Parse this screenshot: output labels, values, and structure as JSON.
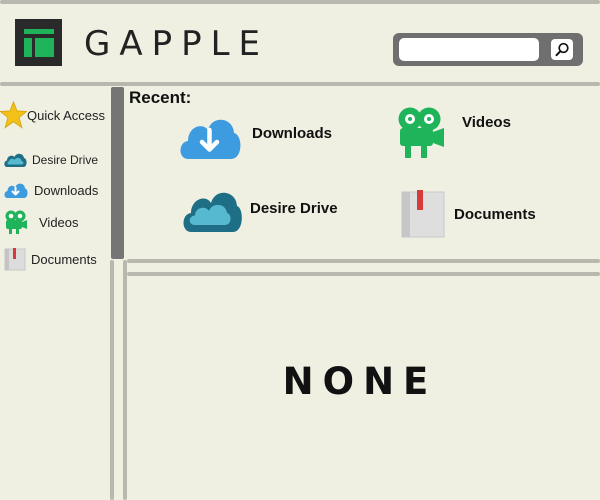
{
  "header": {
    "brand": "GAPPLE",
    "search": {
      "placeholder": "",
      "value": ""
    }
  },
  "sidebar": {
    "items": [
      {
        "label": "Quick Access",
        "icon": "star-icon"
      },
      {
        "label": "Desire Drive",
        "icon": "cloud-icon"
      },
      {
        "label": "Downloads",
        "icon": "download-cloud-icon"
      },
      {
        "label": "Videos",
        "icon": "video-camera-icon"
      },
      {
        "label": "Documents",
        "icon": "document-icon"
      }
    ]
  },
  "recent": {
    "heading": "Recent:",
    "items": [
      {
        "label": "Downloads",
        "icon": "download-cloud-icon"
      },
      {
        "label": "Videos",
        "icon": "video-camera-icon"
      },
      {
        "label": "Desire Drive",
        "icon": "cloud-icon"
      },
      {
        "label": "Documents",
        "icon": "document-icon"
      }
    ]
  },
  "content": {
    "empty_text": "NONE"
  },
  "colors": {
    "background": "#efefe2",
    "divider": "#b8b8ae",
    "star": "#f2c21b",
    "download_blue": "#3d9be0",
    "drive_teal": "#1e6f86",
    "video_green": "#1fb45a",
    "document_red": "#d63a3a"
  }
}
